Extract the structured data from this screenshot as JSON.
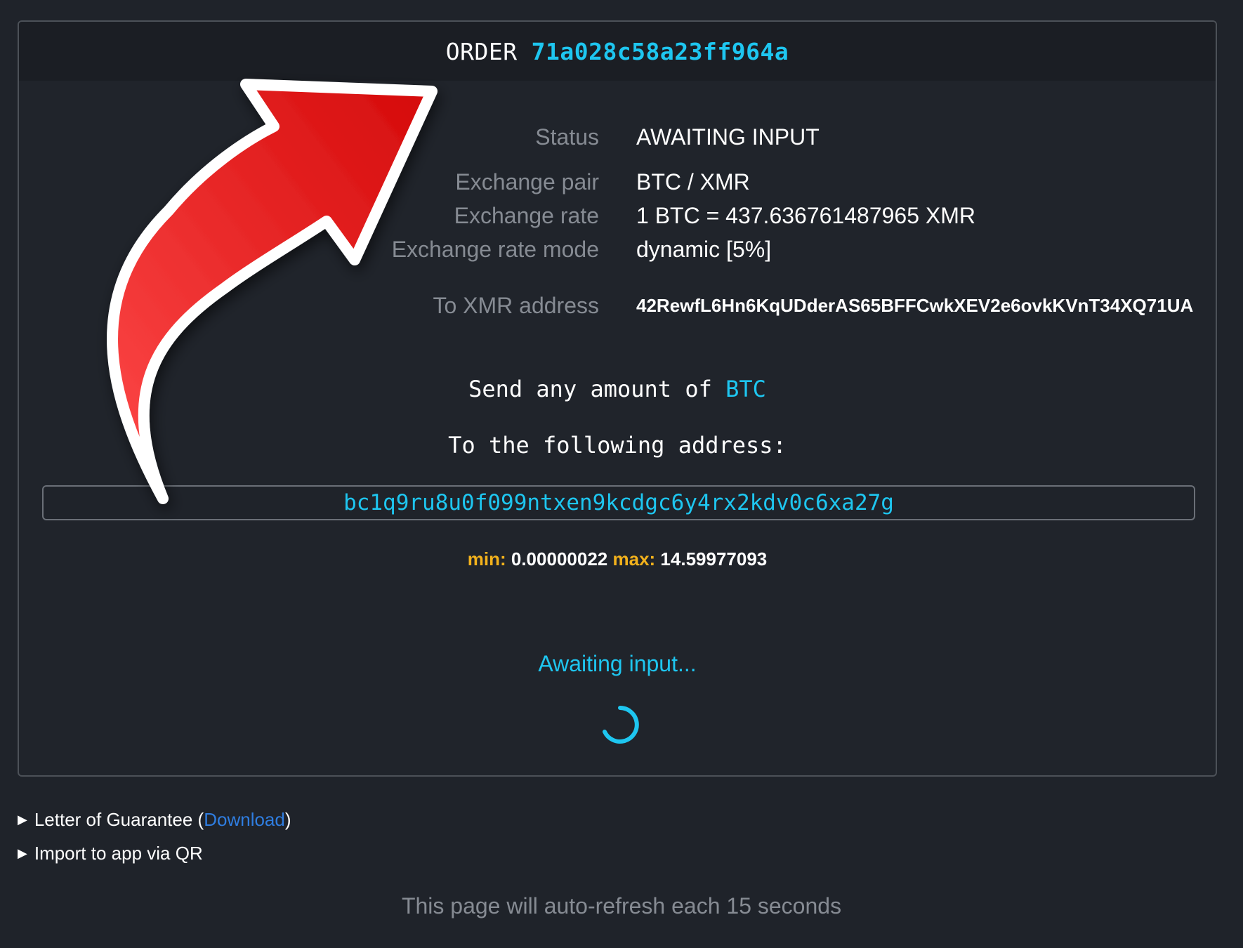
{
  "order": {
    "label": "ORDER",
    "id": "71a028c58a23ff964a"
  },
  "info": {
    "status_label": "Status",
    "status_value": "AWAITING INPUT",
    "pair_label": "Exchange pair",
    "pair_value": "BTC / XMR",
    "rate_label": "Exchange rate",
    "rate_value": "1 BTC = 437.636761487965 XMR",
    "mode_label": "Exchange rate mode",
    "mode_value": "dynamic [5%]",
    "to_label": "To XMR address",
    "to_value": "42RewfL6Hn6KqUDderAS65BFFCwkXEV2e6ovkKVnT34XQ71UA"
  },
  "instructions": {
    "send_prefix": "Send any amount of ",
    "send_currency": "BTC",
    "to_following": "To the following address:"
  },
  "deposit_address": "bc1q9ru8u0f099ntxen9kcdgc6y4rx2kdv0c6xa27g",
  "limits": {
    "min_label": "min:",
    "min_value": "0.00000022",
    "max_label": "max:",
    "max_value": "14.59977093"
  },
  "awaiting_text": "Awaiting input...",
  "expanders": {
    "guarantee_prefix": "Letter of Guarantee (",
    "guarantee_link": "Download",
    "guarantee_suffix": ")",
    "import_qr": "Import to app via QR"
  },
  "footer_note": "This page will auto-refresh each 15 seconds",
  "colors": {
    "background": "#1f232a",
    "accent": "#1ec6f0",
    "limit_label": "#f3b21c",
    "link": "#2f7de0",
    "muted": "#868b93",
    "arrow": "#e8201f"
  },
  "icons": {
    "spinner": "loading-spinner-icon",
    "expand": "triangle-right-icon",
    "arrow": "red-curved-arrow-annotation"
  }
}
